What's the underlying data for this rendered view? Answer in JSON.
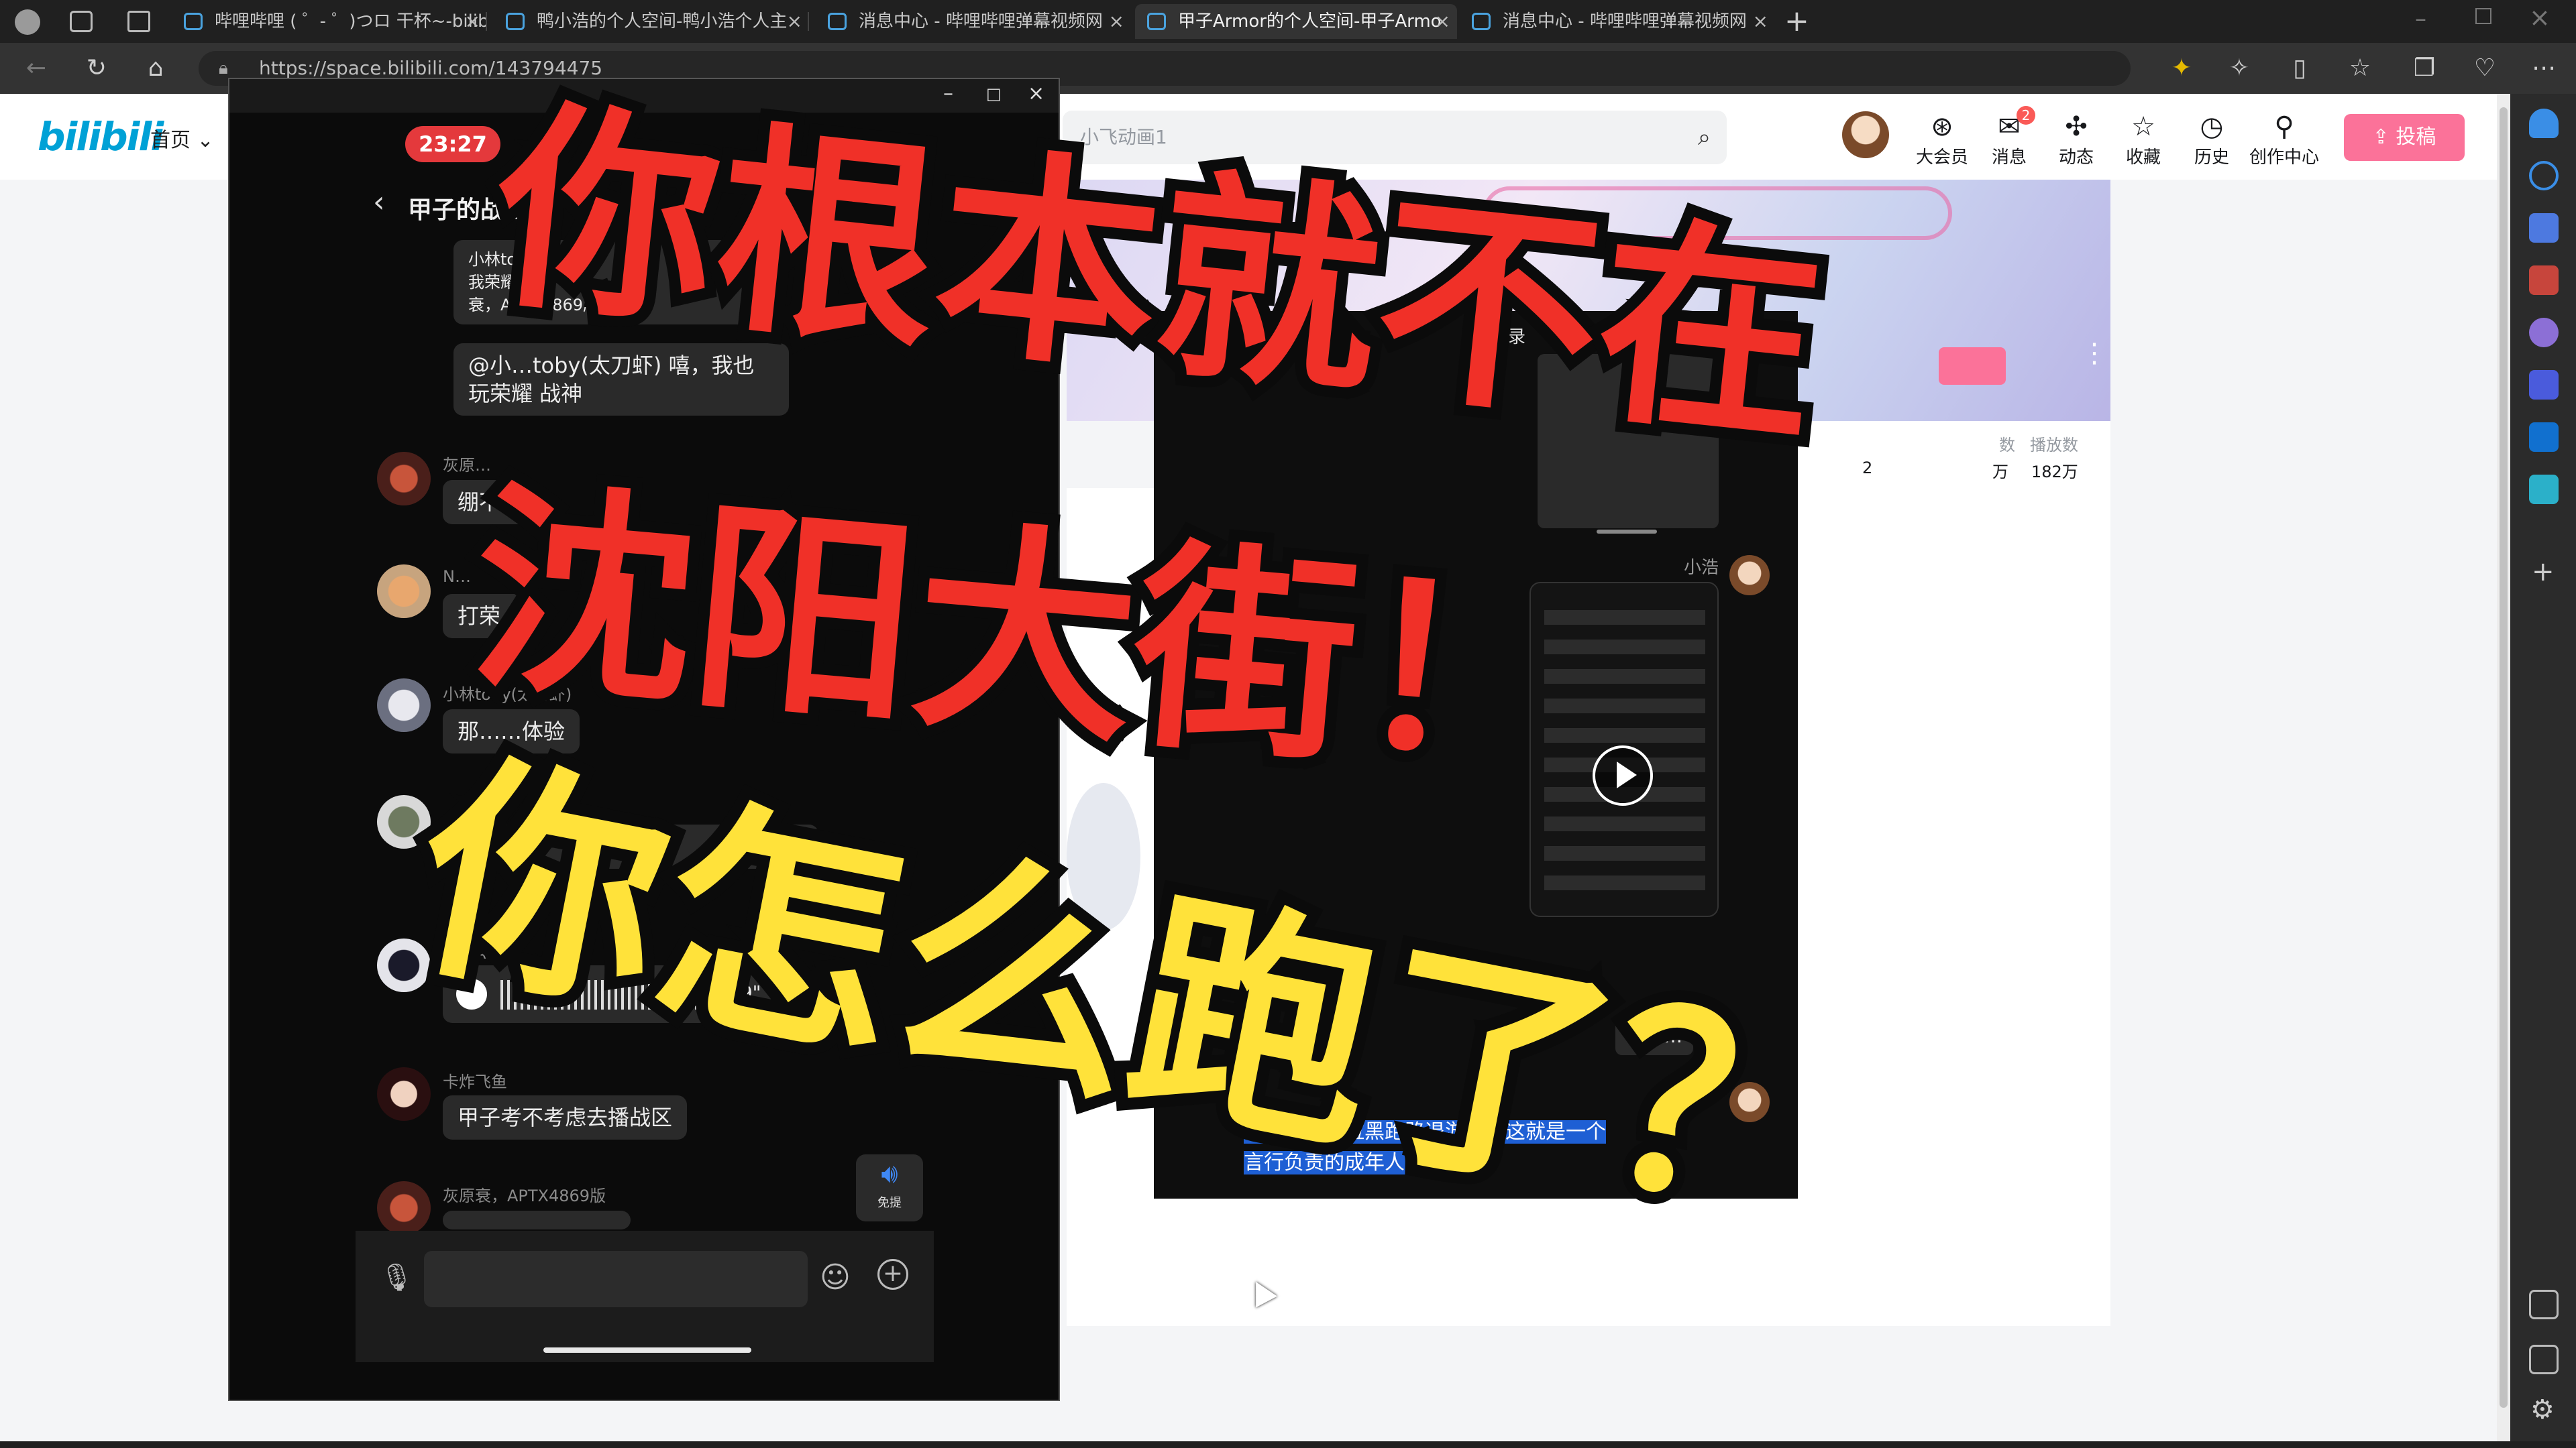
{
  "browser": {
    "tabs": [
      {
        "label": "哔哩哔哩 ( ゜- ゜)つロ 干杯~-bilib",
        "active": false
      },
      {
        "label": "鸭小浩的个人空间-鸭小浩个人主",
        "active": false
      },
      {
        "label": "消息中心 - 哔哩哔哩弹幕视频网",
        "active": false
      },
      {
        "label": "甲子Armor的个人空间-甲子Armo",
        "active": true
      },
      {
        "label": "消息中心 - 哔哩哔哩弹幕视频网",
        "active": false
      }
    ],
    "url": "https://space.bilibili.com/143794475"
  },
  "bilibili": {
    "logo": "bilibili",
    "nav_home": "首页",
    "search_placeholder": "小飞动画1",
    "header_items": [
      {
        "label": "大会员",
        "icon": "vip-icon"
      },
      {
        "label": "消息",
        "icon": "message-icon",
        "badge": "2"
      },
      {
        "label": "动态",
        "icon": "dynamic-icon"
      },
      {
        "label": "收藏",
        "icon": "favorite-icon"
      },
      {
        "label": "历史",
        "icon": "history-icon"
      },
      {
        "label": "创作中心",
        "icon": "creator-icon"
      }
    ],
    "upload_label": "投稿",
    "stats": {
      "label1": "数",
      "label2": "播放数",
      "v1": "2",
      "v2": "万",
      "v3": "182万"
    }
  },
  "phone": {
    "time": "23:27",
    "chat_title": "甲子的战士",
    "messages": [
      {
        "name": "小林toby(太刀虾)",
        "lines": [
          "小林tob…",
          "我荣耀…",
          "衰，APTX4869版"
        ]
      },
      {
        "name": "",
        "text": "@小…toby(太刀虾) 嘻，我也玩荣耀 战神"
      },
      {
        "name": "灰原…",
        "text": "绷不…"
      },
      {
        "name": "N…",
        "text": "打荣人"
      },
      {
        "name": "小林toby(太刀虾)",
        "text": "那……体验"
      },
      {
        "name": "",
        "text": "…多…"
      },
      {
        "name": "…子Ar…",
        "voice": "39\""
      },
      {
        "name": "卡炸飞鱼",
        "text": "甲子考不考虑去播战区"
      },
      {
        "name": "灰原衰，APTX4869版",
        "text": ""
      }
    ],
    "speaker_label": "免提"
  },
  "video": {
    "title_fragment": "记录",
    "name_small": "小浩",
    "reply_text": "丢人…",
    "caption_line1": "说的销号变拉黑跑路退游了，这就是一个",
    "caption_line2": "言行负责的成年人 大老爷们"
  },
  "overlay": {
    "line1": "你根本就不在",
    "line2": "沈阳大街！",
    "line3": "你怎么跑了？"
  }
}
